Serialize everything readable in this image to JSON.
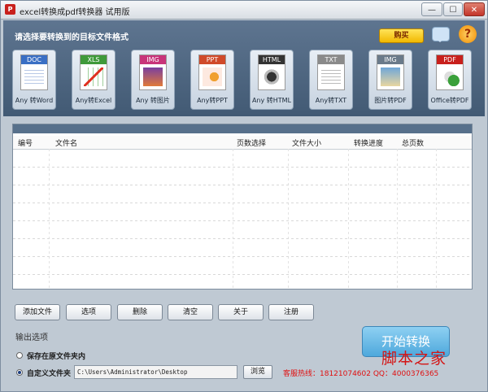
{
  "window": {
    "title": "excel转换成pdf转换器 试用版",
    "minimize": "—",
    "maximize": "☐",
    "close": "✕"
  },
  "header": {
    "title": "请选择要转换到的目标文件格式",
    "buy_label": "购买",
    "help": "?"
  },
  "formats": [
    {
      "tag": "DOC",
      "label": "Any 转Word",
      "color": "#3a6fc4"
    },
    {
      "tag": "XLS",
      "label": "Any转Excel",
      "color": "#3f9a3a"
    },
    {
      "tag": "IMG",
      "label": "Any 转图片",
      "color": "#c8347a"
    },
    {
      "tag": "PPT",
      "label": "Any转PPT",
      "color": "#d04a2a"
    },
    {
      "tag": "HTML",
      "label": "Any 转HTML",
      "color": "#333333"
    },
    {
      "tag": "TXT",
      "label": "Any转TXT",
      "color": "#8a8a8a"
    },
    {
      "tag": "IMG",
      "label": "图片转PDF",
      "color": "#6a7a8a"
    },
    {
      "tag": "PDF",
      "label": "Office转PDF",
      "color": "#c8201c"
    }
  ],
  "filelist": {
    "columns": [
      "编号",
      "文件名",
      "页数选择",
      "文件大小",
      "转换进度",
      "总页数"
    ]
  },
  "actions": [
    "添加文件",
    "选项",
    "删除",
    "清空",
    "关于",
    "注册"
  ],
  "output": {
    "section_label": "输出选项",
    "option_source": "保存在原文件夹内",
    "option_custom": "自定义文件夹",
    "path": "C:\\Users\\Administrator\\Desktop",
    "browse": "浏览"
  },
  "hotline": "客服热线：18121074602 QQ：4000376365",
  "start": "开始转换",
  "watermark": "脚本之家"
}
